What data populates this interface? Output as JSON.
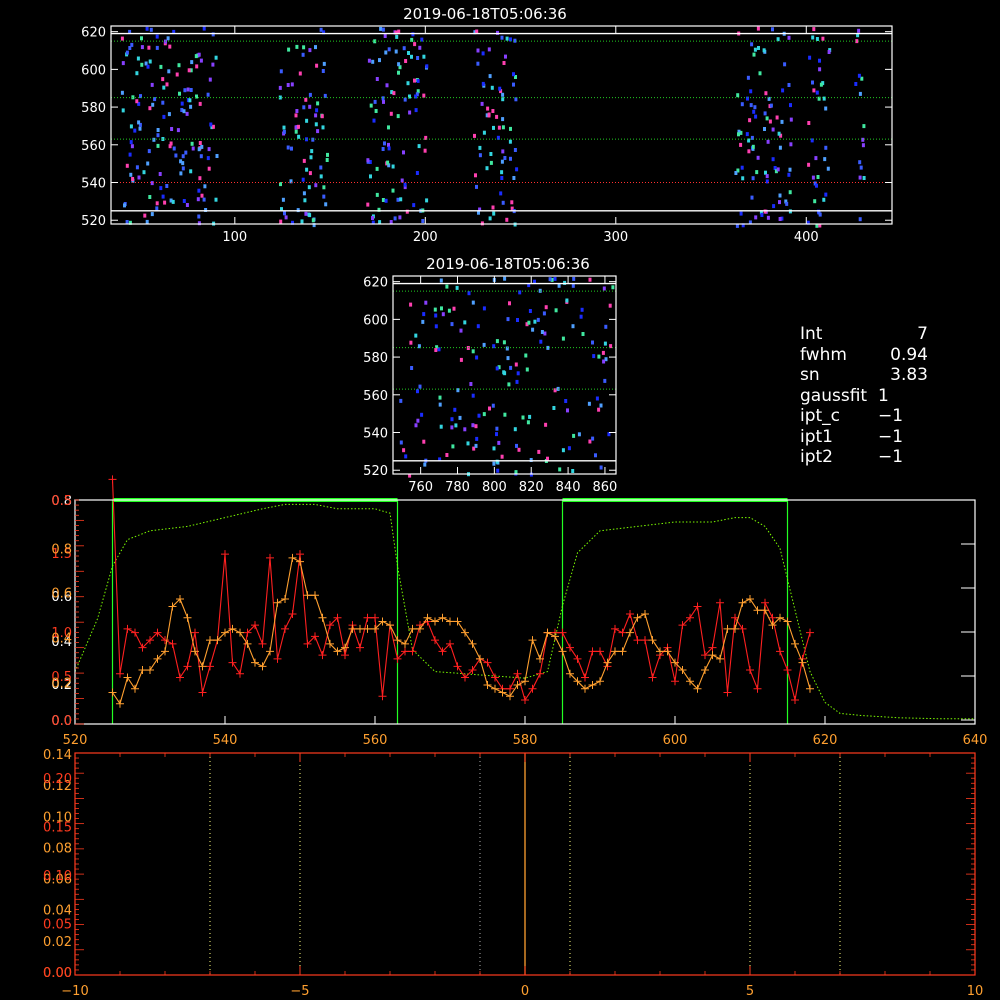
{
  "colors": {
    "background": "#000000",
    "frame": "#ffffff",
    "axis_red": "#ff3b1f",
    "axis_orange": "#ffa030",
    "green_curve": "#7cfc00",
    "green_box": "#22ff22",
    "red_line": "#ff2020",
    "orange_line": "#ffa030",
    "spectrum_dots": [
      "#1a2cff",
      "#3a5cff",
      "#4fa0ff",
      "#33d6e0",
      "#40e8a0",
      "#8840ff",
      "#ff40b0"
    ]
  },
  "info": {
    "rows": [
      {
        "label": "Int",
        "value": "7"
      },
      {
        "label": "fwhm",
        "value": "0.94"
      },
      {
        "label": "sn",
        "value": "3.83"
      },
      {
        "label": "gaussfit",
        "value": "1"
      },
      {
        "label": "ipt_c",
        "value": "−1"
      },
      {
        "label": "ipt1",
        "value": "−1"
      },
      {
        "label": "ipt2",
        "value": "−1"
      }
    ]
  },
  "chart_data": [
    {
      "type": "heatmap",
      "id": "top-spectrogram",
      "title": "2019-06-18T05:06:36",
      "xlim": [
        35,
        445
      ],
      "ylim": [
        518,
        623
      ],
      "xticks": [
        100,
        200,
        300,
        400
      ],
      "yticks": [
        520,
        540,
        560,
        580,
        600,
        620
      ],
      "white_hlines": [
        525,
        619
      ],
      "green_hlines": [
        563,
        585,
        615
      ],
      "red_hlines": [
        540
      ],
      "dot_columns": [
        {
          "x": [
            40,
            90
          ]
        },
        {
          "x": [
            122,
            148
          ]
        },
        {
          "x": [
            168,
            200
          ]
        },
        {
          "x": [
            225,
            248
          ]
        },
        {
          "x": [
            362,
            392
          ]
        },
        {
          "x": [
            400,
            412
          ]
        },
        {
          "x": [
            425,
            430
          ]
        }
      ]
    },
    {
      "type": "heatmap",
      "id": "zoom-spectrogram",
      "title": "2019-06-18T05:06:36",
      "xlim": [
        745,
        866
      ],
      "ylim": [
        518,
        623
      ],
      "xticks": [
        760,
        780,
        800,
        820,
        840,
        860
      ],
      "yticks": [
        520,
        540,
        560,
        580,
        600,
        620
      ],
      "white_hlines": [
        525,
        619
      ],
      "green_hlines": [
        563,
        585,
        615
      ]
    },
    {
      "type": "line",
      "id": "profile",
      "xlim": [
        520,
        640
      ],
      "xticks": [
        520,
        540,
        560,
        580,
        600,
        620,
        640
      ],
      "left_axis_white": {
        "ylim": [
          0,
          0.5
        ],
        "ticks": [
          "0.0",
          "0.2",
          "0.4",
          "0.6",
          "0.8"
        ]
      },
      "left_axis_red": {
        "ylim": [
          0,
          2.2
        ],
        "ticks": [
          "0.0",
          "0.5",
          "1.0",
          "1.5",
          "0.5"
        ]
      },
      "left_axis_orange": {
        "ticks": [
          "0.2",
          "0.4",
          "0.6",
          "0.8"
        ]
      },
      "green_boxes": [
        [
          525,
          563
        ],
        [
          585,
          615
        ]
      ],
      "green_curve": {
        "x": [
          520,
          523,
          525,
          527,
          530,
          535,
          540,
          545,
          548,
          552,
          555,
          558,
          560,
          562,
          563,
          565,
          568,
          572,
          576,
          580,
          583,
          585,
          587,
          590,
          595,
          600,
          605,
          608,
          610,
          612,
          614,
          616,
          618,
          620,
          622,
          625,
          630,
          635,
          640
        ],
        "y": [
          0.11,
          0.23,
          0.35,
          0.41,
          0.43,
          0.44,
          0.46,
          0.48,
          0.49,
          0.49,
          0.48,
          0.48,
          0.48,
          0.47,
          0.35,
          0.16,
          0.11,
          0.105,
          0.1,
          0.095,
          0.11,
          0.26,
          0.38,
          0.43,
          0.44,
          0.45,
          0.45,
          0.46,
          0.46,
          0.44,
          0.39,
          0.25,
          0.11,
          0.04,
          0.015,
          0.01,
          0.005,
          0.003,
          0.003
        ]
      },
      "series": [
        {
          "x": [
            525,
            526,
            527,
            528,
            529,
            530,
            531,
            532,
            533,
            534,
            535,
            536,
            537,
            538,
            539,
            540,
            541,
            542,
            543,
            544,
            545,
            546,
            547,
            548,
            549,
            550,
            551,
            552,
            553,
            554,
            555,
            556,
            557,
            558,
            559,
            560,
            561,
            562,
            563,
            564,
            565,
            566,
            567,
            568,
            569,
            570,
            571,
            572,
            573,
            574,
            575,
            576,
            577,
            578,
            579,
            580,
            581,
            582,
            583,
            584,
            585,
            586,
            587,
            588,
            589,
            590,
            591,
            592,
            593,
            594,
            595,
            596,
            597,
            598,
            599,
            600,
            601,
            602,
            603,
            604,
            605,
            606,
            607,
            608,
            609,
            610,
            611,
            612,
            613,
            614,
            615,
            616,
            617,
            618
          ],
          "y": [
            0.62,
            0.1,
            0.22,
            0.21,
            0.17,
            0.19,
            0.21,
            0.19,
            0.18,
            0.09,
            0.12,
            0.21,
            0.05,
            0.12,
            0.19,
            0.42,
            0.13,
            0.1,
            0.21,
            0.23,
            0.18,
            0.41,
            0.14,
            0.22,
            0.26,
            0.42,
            0.18,
            0.2,
            0.15,
            0.23,
            0.25,
            0.15,
            0.23,
            0.17,
            0.25,
            0.25,
            0.04,
            0.23,
            0.14,
            0.16,
            0.16,
            0.23,
            0.24,
            0.19,
            0.16,
            0.18,
            0.12,
            0.09,
            0.11,
            0.14,
            0.13,
            0.09,
            0.06,
            0.06,
            0.1,
            0.03,
            0.06,
            0.1,
            0.21,
            0.21,
            0.21,
            0.17,
            0.14,
            0.09,
            0.16,
            0.16,
            0.12,
            0.22,
            0.21,
            0.26,
            0.19,
            0.19,
            0.09,
            0.15,
            0.17,
            0.08,
            0.23,
            0.25,
            0.28,
            0.15,
            0.17,
            0.29,
            0.05,
            0.25,
            0.22,
            0.11,
            0.06,
            0.29,
            0.25,
            0.16,
            0.11,
            0.03,
            0.14,
            0.21
          ]
        },
        {
          "x": [
            525,
            526,
            527,
            528,
            529,
            530,
            531,
            532,
            533,
            534,
            535,
            536,
            537,
            538,
            539,
            540,
            541,
            542,
            543,
            544,
            545,
            546,
            547,
            548,
            549,
            550,
            551,
            552,
            553,
            554,
            555,
            556,
            557,
            558,
            559,
            560,
            561,
            562,
            563,
            564,
            565,
            566,
            567,
            568,
            569,
            570,
            571,
            572,
            573,
            574,
            575,
            576,
            577,
            578,
            579,
            580,
            581,
            582,
            583,
            584,
            585,
            586,
            587,
            588,
            589,
            590,
            591,
            592,
            593,
            594,
            595,
            596,
            597,
            598,
            599,
            600,
            601,
            602,
            603,
            604,
            605,
            606,
            607,
            608,
            609,
            610,
            611,
            612,
            613,
            614,
            615,
            616,
            617,
            618
          ],
          "y": [
            0.05,
            0.02,
            0.09,
            0.06,
            0.11,
            0.11,
            0.14,
            0.16,
            0.28,
            0.3,
            0.25,
            0.16,
            0.12,
            0.19,
            0.19,
            0.21,
            0.22,
            0.21,
            0.18,
            0.13,
            0.12,
            0.16,
            0.29,
            0.3,
            0.41,
            0.4,
            0.31,
            0.31,
            0.25,
            0.18,
            0.16,
            0.17,
            0.22,
            0.22,
            0.22,
            0.22,
            0.24,
            0.23,
            0.19,
            0.18,
            0.22,
            0.22,
            0.25,
            0.24,
            0.25,
            0.24,
            0.24,
            0.21,
            0.18,
            0.14,
            0.07,
            0.06,
            0.05,
            0.04,
            0.07,
            0.08,
            0.19,
            0.14,
            0.21,
            0.2,
            0.16,
            0.1,
            0.08,
            0.06,
            0.07,
            0.08,
            0.13,
            0.16,
            0.16,
            0.21,
            0.25,
            0.26,
            0.19,
            0.16,
            0.16,
            0.13,
            0.11,
            0.08,
            0.06,
            0.11,
            0.15,
            0.14,
            0.22,
            0.22,
            0.29,
            0.3,
            0.27,
            0.27,
            0.23,
            0.25,
            0.24,
            0.18,
            0.13,
            0.06
          ]
        }
      ]
    },
    {
      "type": "line",
      "id": "lag-plot",
      "xlim": [
        -10,
        10
      ],
      "xticks": [
        "−10",
        "−5",
        "0",
        "5",
        "10"
      ],
      "left_axis_red": {
        "ticks": [
          "0.00",
          "0.05",
          "0.10",
          "0.15",
          "0.20"
        ]
      },
      "left_axis_orange": {
        "ylim": [
          0,
          0.14
        ],
        "ticks": [
          "0.00",
          "0.02",
          "0.04",
          "0.06",
          "0.08",
          "0.10",
          "0.12",
          "0.14"
        ]
      },
      "vlines_dotted_yellow": [
        -7,
        -5,
        1,
        5,
        7
      ],
      "vlines_dotted_gray": [
        -1
      ],
      "vline_solid_orange": 0
    }
  ]
}
